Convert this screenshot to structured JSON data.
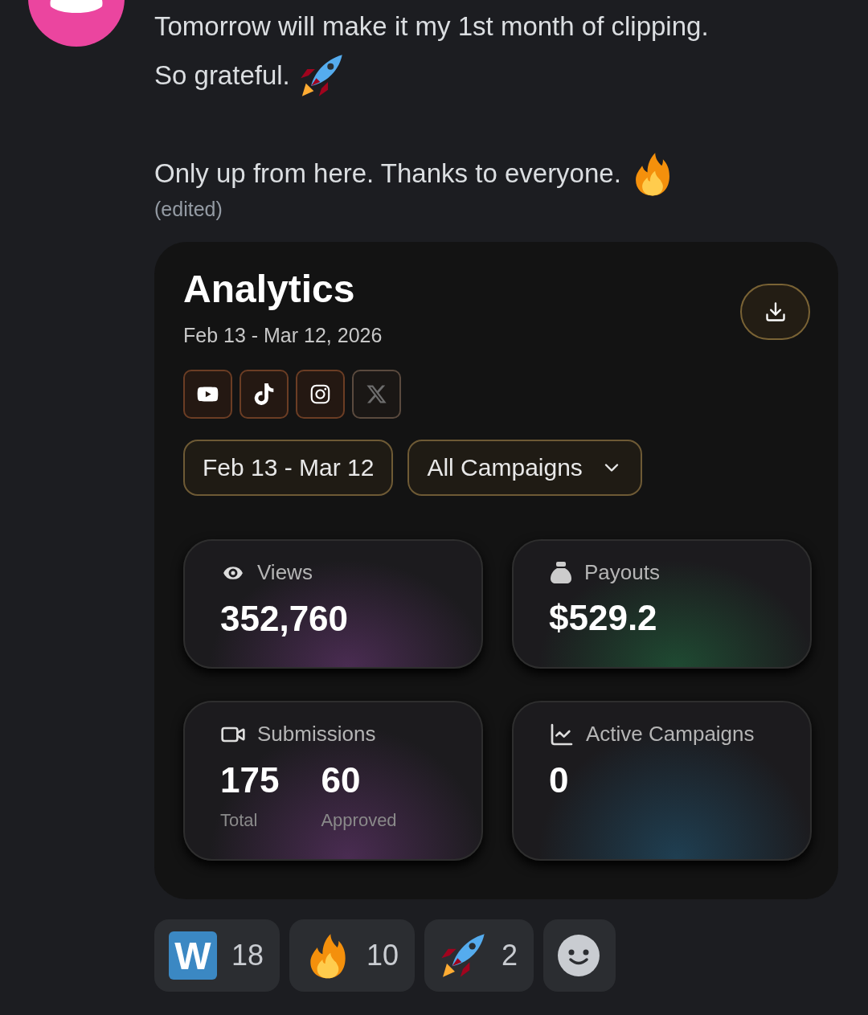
{
  "message": {
    "paragraphs": [
      {
        "lines": [
          {
            "text": "Tomorrow will make it my 1st month of clipping."
          },
          {
            "text": "So grateful.",
            "kind": "rocket"
          }
        ]
      },
      {
        "lines": [
          {
            "text": "Only up from here. Thanks to everyone.",
            "kind": "fire"
          }
        ]
      }
    ],
    "edited": "(edited)"
  },
  "card": {
    "title": "Analytics",
    "date_range": "Feb 13 - Mar 12, 2026",
    "platforms": [
      {
        "kind": "youtube",
        "selected": true
      },
      {
        "kind": "tiktok",
        "selected": true
      },
      {
        "kind": "instagram",
        "selected": true
      },
      {
        "kind": "x",
        "selected": false
      }
    ],
    "filters": [
      {
        "kind": "date",
        "label": "Feb 13 - Mar 12"
      },
      {
        "kind": "dropdown",
        "label": "All Campaigns"
      }
    ],
    "stats": [
      {
        "kind": "views",
        "label": "Views",
        "color": "#4a2c52",
        "values": [
          {
            "value": "352,760"
          }
        ]
      },
      {
        "kind": "payouts",
        "label": "Payouts",
        "color": "#1f4a32",
        "values": [
          {
            "value": "$529.2"
          }
        ]
      },
      {
        "kind": "submissions",
        "label": "Submissions",
        "color": "#4a2c52",
        "values": [
          {
            "value": "175",
            "caption": "Total"
          },
          {
            "value": "60",
            "caption": "Approved"
          }
        ]
      },
      {
        "kind": "campaigns",
        "label": "Active Campaigns",
        "color": "#1f3f52",
        "values": [
          {
            "value": "0"
          }
        ]
      }
    ]
  },
  "reactions": [
    {
      "kind": "letter",
      "emoji_text": "W",
      "count": "18"
    },
    {
      "kind": "fire",
      "count": "10"
    },
    {
      "kind": "rocket",
      "count": "2"
    }
  ]
}
